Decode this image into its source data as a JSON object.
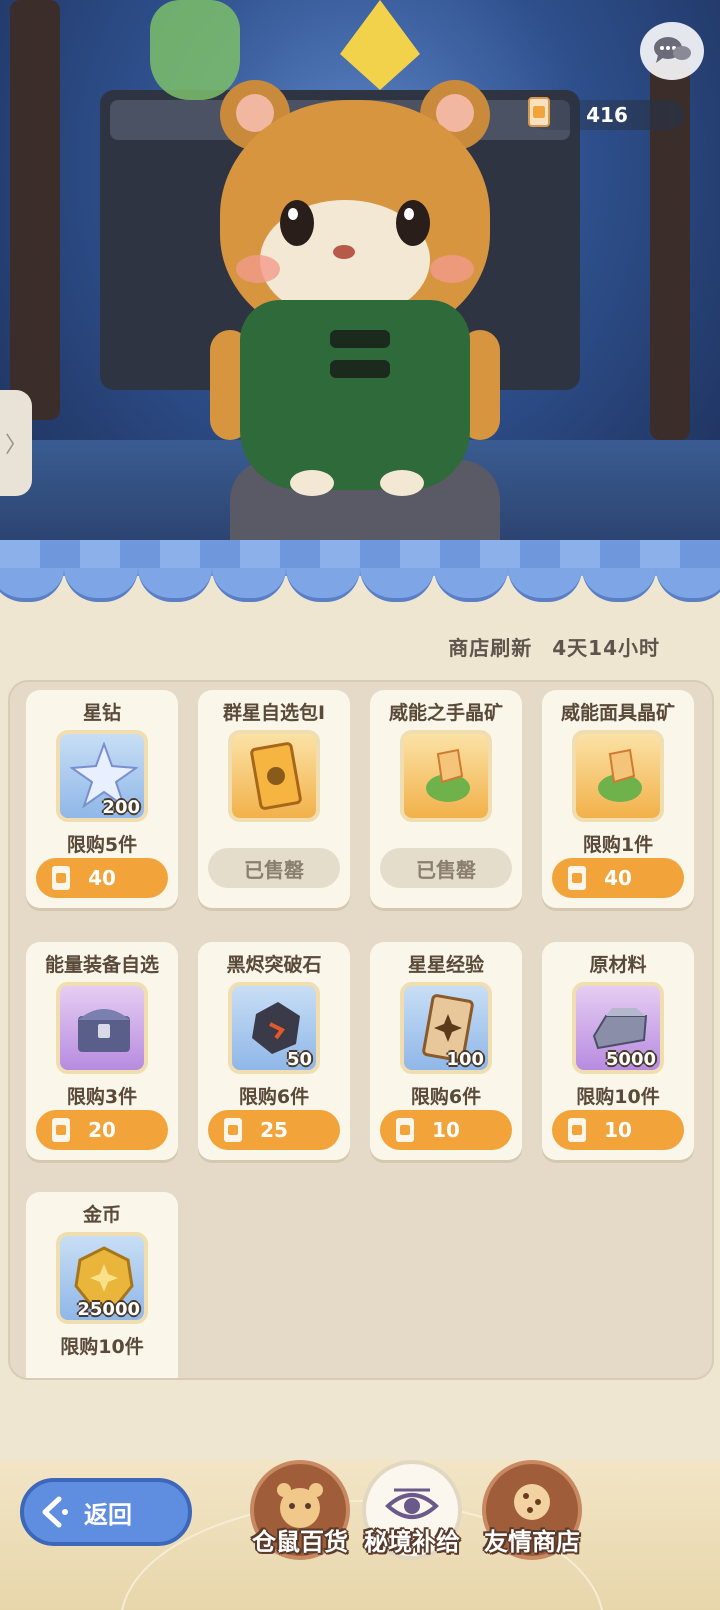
{
  "currency": {
    "amount": "416",
    "icon": "ticket-icon"
  },
  "shop": {
    "refresh_label": "商店刷新",
    "refresh_time": "4天14小时",
    "items": [
      {
        "name": "星钻",
        "qty": "200",
        "limit": "限购5件",
        "price": "40",
        "sold": false,
        "icon": "star-crystal-icon",
        "color": "blue"
      },
      {
        "name": "群星自选包Ⅰ",
        "qty": "",
        "limit": "",
        "price": "",
        "sold": true,
        "sold_label": "已售罄",
        "icon": "card-pack-icon",
        "color": "gold"
      },
      {
        "name": "威能之手晶矿",
        "qty": "",
        "limit": "",
        "price": "",
        "sold": true,
        "sold_label": "已售罄",
        "icon": "ore-plant-icon",
        "color": "gold"
      },
      {
        "name": "威能面具晶矿",
        "qty": "",
        "limit": "限购1件",
        "price": "40",
        "sold": false,
        "icon": "ore-plant-icon",
        "color": "gold"
      },
      {
        "name": "能量装备自选",
        "qty": "",
        "limit": "限购3件",
        "price": "20",
        "sold": false,
        "icon": "chest-icon",
        "color": "purple"
      },
      {
        "name": "黑烬突破石",
        "qty": "50",
        "limit": "限购6件",
        "price": "25",
        "sold": false,
        "icon": "ember-stone-icon",
        "color": "blue"
      },
      {
        "name": "星星经验",
        "qty": "100",
        "limit": "限购6件",
        "price": "10",
        "sold": false,
        "icon": "star-card-icon",
        "color": "blue"
      },
      {
        "name": "原材料",
        "qty": "5000",
        "limit": "限购10件",
        "price": "10",
        "sold": false,
        "icon": "ingot-icon",
        "color": "purple"
      },
      {
        "name": "金币",
        "qty": "25000",
        "limit": "限购10件",
        "price": "",
        "sold": false,
        "icon": "gold-coin-icon",
        "color": "blue"
      }
    ]
  },
  "nav": {
    "back_label": "返回",
    "tabs": [
      {
        "label": "仓鼠百货",
        "icon": "hamster-icon",
        "active": false
      },
      {
        "label": "秘境补给",
        "icon": "eye-icon",
        "active": true
      },
      {
        "label": "友情商店",
        "icon": "cookie-icon",
        "active": false
      }
    ]
  },
  "colors": {
    "accent": "#f2a43a",
    "awning": "#7ea5e6",
    "back_button": "#5f8ee0"
  }
}
